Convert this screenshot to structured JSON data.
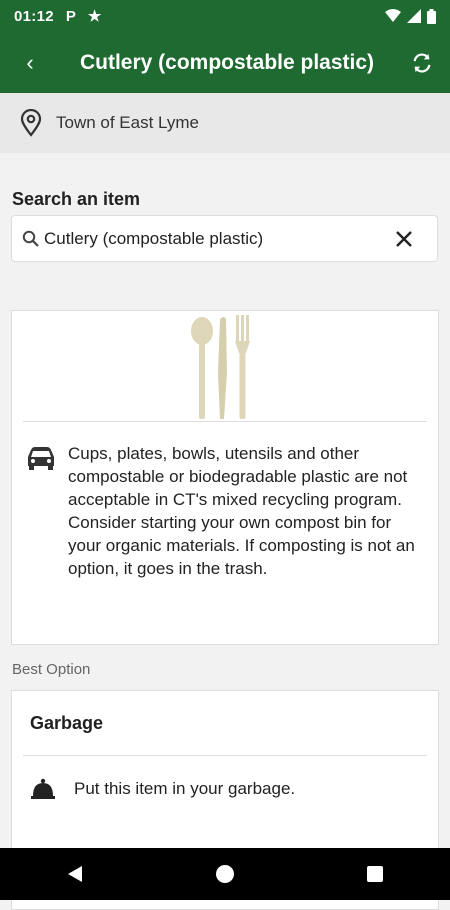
{
  "status_bar": {
    "time": "01:12",
    "icons": [
      "parking-icon",
      "star-icon",
      "wifi-icon",
      "signal-icon",
      "battery-icon"
    ],
    "parking_glyph": "P",
    "star_glyph": "★"
  },
  "toolbar": {
    "back_glyph": "‹",
    "title": "Cutlery (compostable plastic)",
    "refresh_icon": "refresh-icon",
    "color": "#1e6a30"
  },
  "location": {
    "icon": "location-pin-icon",
    "town": "Town of East Lyme"
  },
  "search": {
    "label": "Search an item",
    "value": "Cutlery (compostable plastic)",
    "search_icon": "search-icon",
    "clear_icon": "close-icon"
  },
  "item_card": {
    "image": "cutlery-image",
    "info_icon": "car-icon",
    "description": "Cups, plates, bowls, utensils and other compostable or biodegradable plastic are not acceptable in CT's mixed recycling program.\nConsider starting your own compost bin for your organic materials. If composting is not an option, it goes in the trash."
  },
  "best_option": {
    "label": "Best Option",
    "title": "Garbage",
    "instruction_icon": "bell-icon",
    "instruction": "Put this item in your garbage."
  },
  "nav_bar": {
    "icons": [
      "back-triangle-icon",
      "home-circle-icon",
      "recents-square-icon"
    ]
  }
}
